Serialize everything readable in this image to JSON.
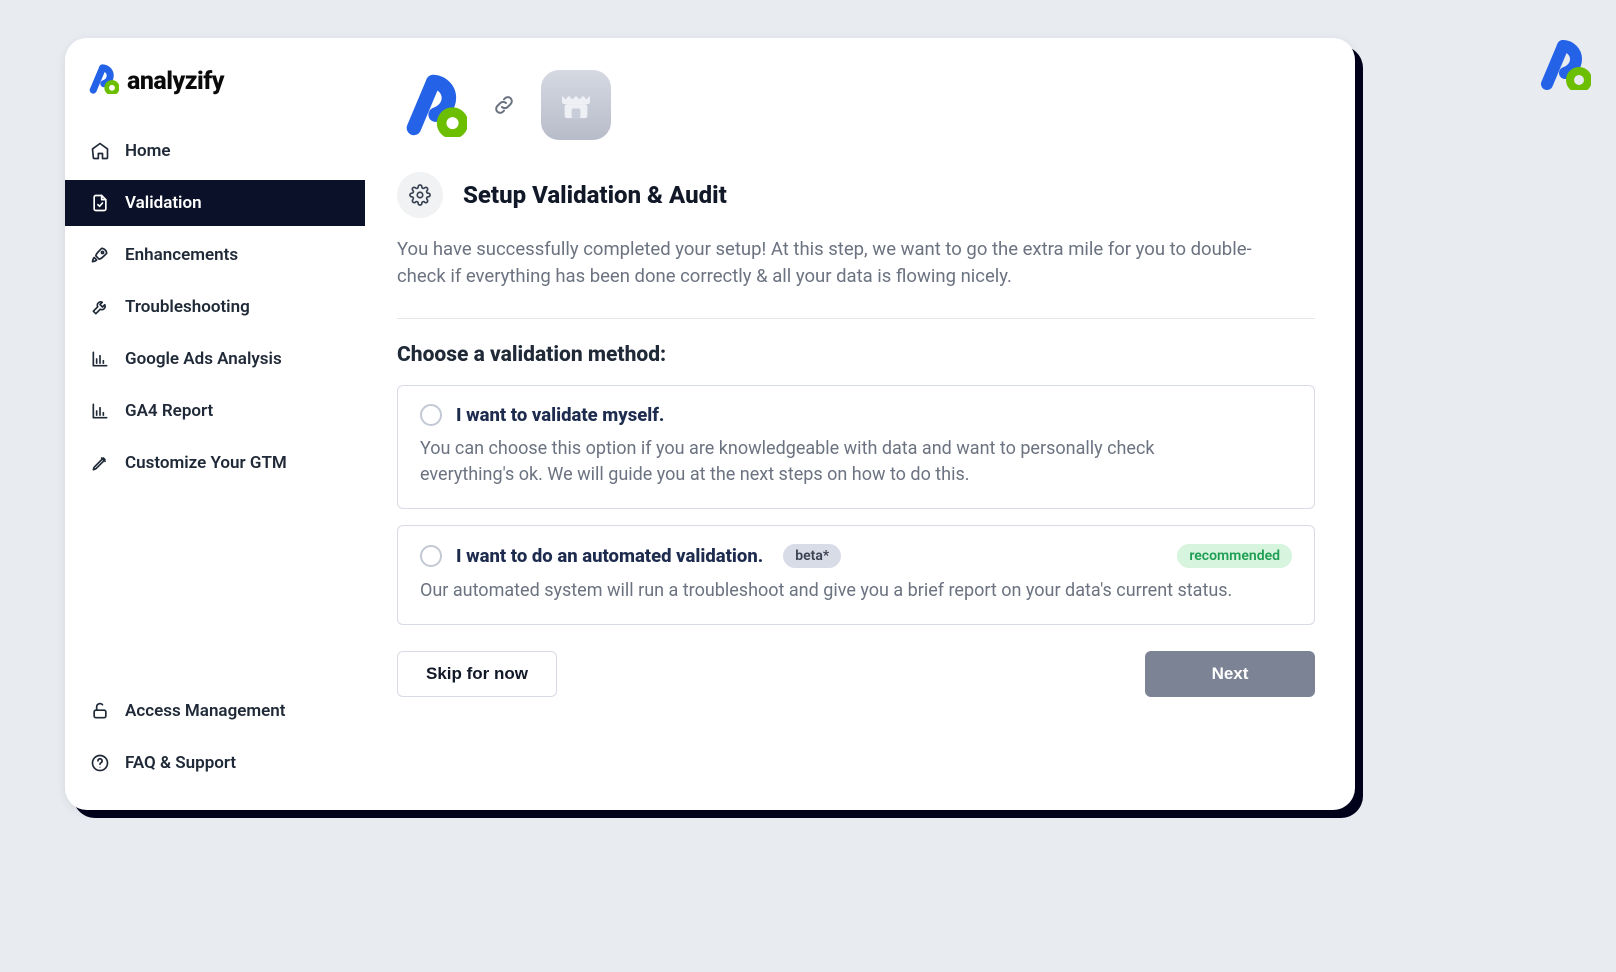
{
  "brand": {
    "name": "analyzify"
  },
  "sidebar": {
    "items": [
      {
        "label": "Home"
      },
      {
        "label": "Validation"
      },
      {
        "label": "Enhancements"
      },
      {
        "label": "Troubleshooting"
      },
      {
        "label": "Google Ads Analysis"
      },
      {
        "label": "GA4 Report"
      },
      {
        "label": "Customize Your GTM"
      }
    ],
    "bottom": [
      {
        "label": "Access Management"
      },
      {
        "label": "FAQ & Support"
      }
    ],
    "activeIndex": 1
  },
  "page": {
    "title": "Setup Validation & Audit",
    "lead": "You have successfully completed your setup! At this step, we want to go the extra mile for you to double-check if everything has been done correctly & all your data is flowing nicely.",
    "choose_label": "Choose a validation method:",
    "options": [
      {
        "title": "I want to validate myself.",
        "desc": "You can choose this option if you are knowledgeable with data and want to personally check everything's ok. We will guide you at the next steps on how to do this."
      },
      {
        "title": "I want to do an automated validation.",
        "desc": "Our automated system will run a troubleshoot and give you a brief report on your data's current status.",
        "beta": "beta*",
        "rec": "recommended"
      }
    ],
    "buttons": {
      "skip": "Skip for now",
      "next": "Next"
    }
  },
  "colors": {
    "brandBlue": "#2463E8",
    "brandGreen": "#6CBE00",
    "darkNav": "#0A1128"
  }
}
